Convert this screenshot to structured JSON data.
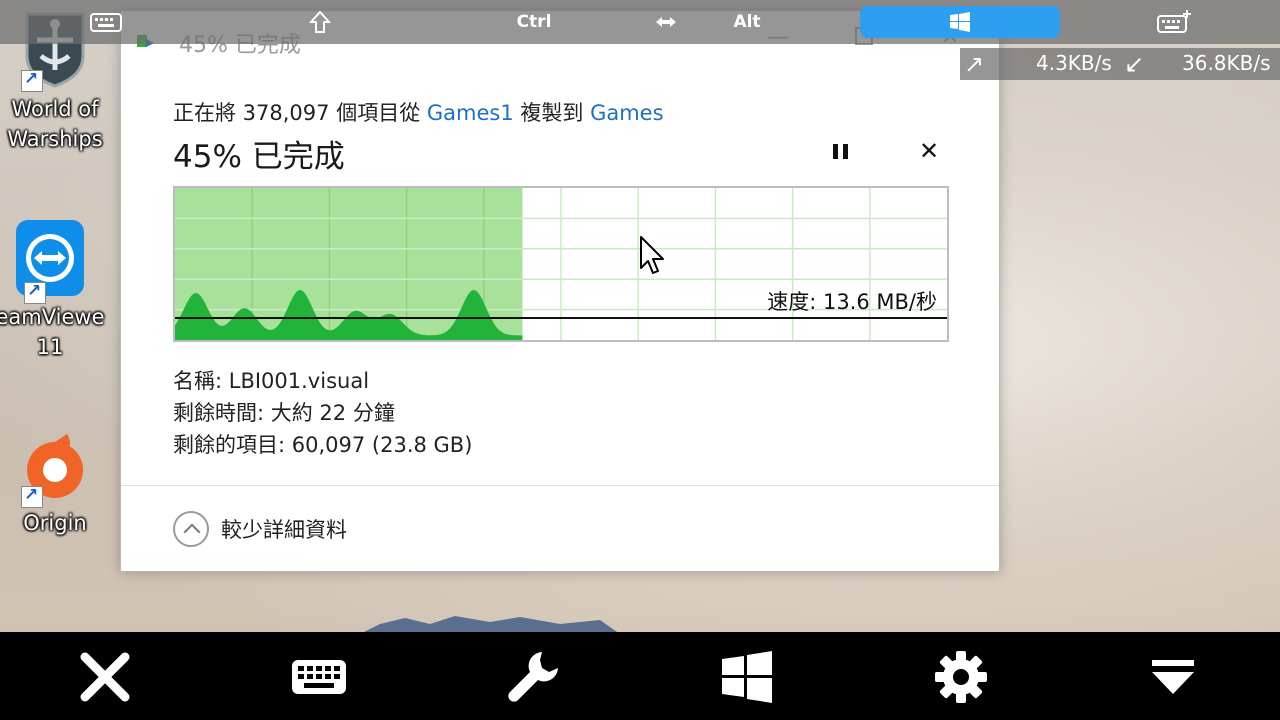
{
  "remote_toolbar": {
    "ctrl_label": "Ctrl",
    "alt_label": "Alt",
    "icons": [
      "keyboard-icon",
      "shift-up-icon",
      "resize-horizontal-icon",
      "windows-key-icon",
      "keyboard-plus-icon"
    ],
    "win_key_color": "#2e9ef0"
  },
  "speed_indicator": {
    "upload": "4.3KB/s",
    "download": "36.8KB/s"
  },
  "desktop_icons": [
    {
      "label": "World of\nWarships"
    },
    {
      "label": "eamViewe\n11"
    },
    {
      "label": "Origin"
    }
  ],
  "dialog": {
    "title": "45% 已完成",
    "copy_line_prefix": "正在將 378,097 個項目從 ",
    "source": "Games1",
    "copy_line_mid": " 複製到 ",
    "destination": "Games",
    "percent_heading": "45% 已完成",
    "progress": 0.45,
    "speed": "速度: 13.6 MB/秒",
    "name_line": "名稱: LBI001.visual",
    "time_line": "剩餘時間: 大約 22 分鐘",
    "items_line": "剩餘的項目: 60,097 (23.8 GB)",
    "less_details": "較少詳細資料",
    "link_color": "#1e6fc8",
    "graph_fill_color": "#a8e29a",
    "graph_wave_color": "#22b43a"
  },
  "bottom_bar": {
    "icons": [
      "close-icon",
      "keyboard-icon",
      "wrench-icon",
      "windows-icon",
      "gear-icon",
      "dropdown-icon"
    ]
  }
}
